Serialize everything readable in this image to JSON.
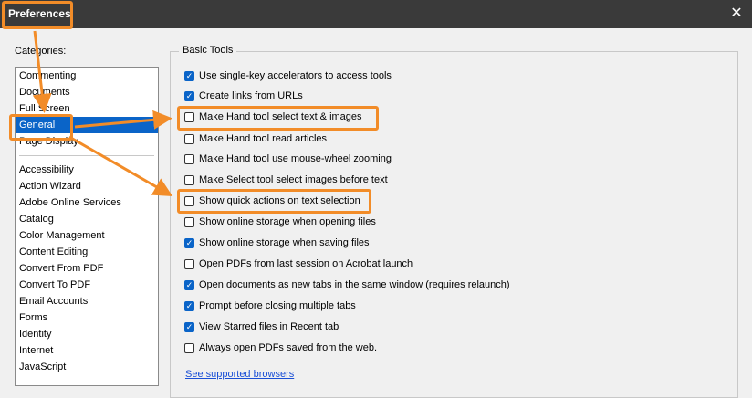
{
  "window": {
    "title": "Preferences",
    "close_glyph": "✕",
    "close_icon": "close-icon"
  },
  "categories_label": "Categories:",
  "categories_top": [
    "Commenting",
    "Documents",
    "Full Screen",
    "General",
    "Page Display"
  ],
  "categories_rest": [
    "Accessibility",
    "Action Wizard",
    "Adobe Online Services",
    "Catalog",
    "Color Management",
    "Content Editing",
    "Convert From PDF",
    "Convert To PDF",
    "Email Accounts",
    "Forms",
    "Identity",
    "Internet",
    "JavaScript"
  ],
  "selected_category": "General",
  "basic_tools": {
    "title": "Basic Tools",
    "options": [
      {
        "label": "Use single-key accelerators to access tools",
        "checked": true
      },
      {
        "label": "Create links from URLs",
        "checked": true
      },
      {
        "label": "Make Hand tool select text & images",
        "checked": false
      },
      {
        "label": "Make Hand tool read articles",
        "checked": false
      },
      {
        "label": "Make Hand tool use mouse-wheel zooming",
        "checked": false
      },
      {
        "label": "Make Select tool select images before text",
        "checked": false
      },
      {
        "label": "Show quick actions on text selection",
        "checked": false
      },
      {
        "label": "Show online storage when opening files",
        "checked": false
      },
      {
        "label": "Show online storage when saving files",
        "checked": true
      },
      {
        "label": "Open PDFs from last session on Acrobat launch",
        "checked": false
      },
      {
        "label": "Open documents as new tabs in the same window (requires relaunch)",
        "checked": true
      },
      {
        "label": "Prompt before closing multiple tabs",
        "checked": true
      },
      {
        "label": "View Starred files in Recent tab",
        "checked": true
      },
      {
        "label": "Always open PDFs saved from the web.",
        "checked": false
      }
    ],
    "link": "See supported browsers"
  },
  "colors": {
    "highlight": "#f28c28",
    "selection": "#0a64c8",
    "titlebar": "#3a3a3a",
    "link": "#1a4fd6"
  }
}
